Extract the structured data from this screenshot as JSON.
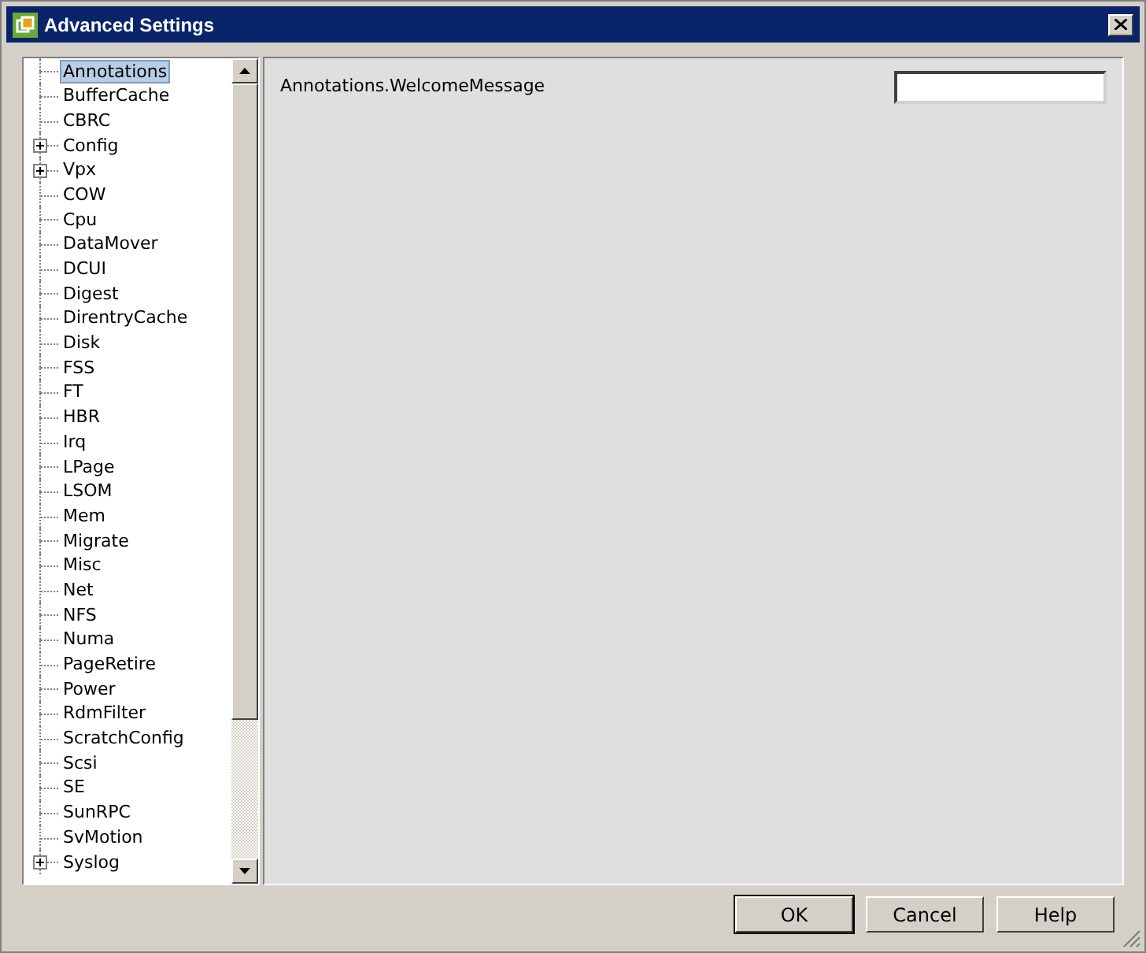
{
  "window": {
    "title": "Advanced Settings"
  },
  "tree": {
    "items": [
      {
        "label": "Annotations",
        "kind": "leaf",
        "selected": true
      },
      {
        "label": "BufferCache",
        "kind": "leaf",
        "selected": false
      },
      {
        "label": "CBRC",
        "kind": "leaf",
        "selected": false
      },
      {
        "label": "Config",
        "kind": "group",
        "selected": false
      },
      {
        "label": "Vpx",
        "kind": "group",
        "selected": false
      },
      {
        "label": "COW",
        "kind": "leaf",
        "selected": false
      },
      {
        "label": "Cpu",
        "kind": "leaf",
        "selected": false
      },
      {
        "label": "DataMover",
        "kind": "leaf",
        "selected": false
      },
      {
        "label": "DCUI",
        "kind": "leaf",
        "selected": false
      },
      {
        "label": "Digest",
        "kind": "leaf",
        "selected": false
      },
      {
        "label": "DirentryCache",
        "kind": "leaf",
        "selected": false
      },
      {
        "label": "Disk",
        "kind": "leaf",
        "selected": false
      },
      {
        "label": "FSS",
        "kind": "leaf",
        "selected": false
      },
      {
        "label": "FT",
        "kind": "leaf",
        "selected": false
      },
      {
        "label": "HBR",
        "kind": "leaf",
        "selected": false
      },
      {
        "label": "Irq",
        "kind": "leaf",
        "selected": false
      },
      {
        "label": "LPage",
        "kind": "leaf",
        "selected": false
      },
      {
        "label": "LSOM",
        "kind": "leaf",
        "selected": false
      },
      {
        "label": "Mem",
        "kind": "leaf",
        "selected": false
      },
      {
        "label": "Migrate",
        "kind": "leaf",
        "selected": false
      },
      {
        "label": "Misc",
        "kind": "leaf",
        "selected": false
      },
      {
        "label": "Net",
        "kind": "leaf",
        "selected": false
      },
      {
        "label": "NFS",
        "kind": "leaf",
        "selected": false
      },
      {
        "label": "Numa",
        "kind": "leaf",
        "selected": false
      },
      {
        "label": "PageRetire",
        "kind": "leaf",
        "selected": false
      },
      {
        "label": "Power",
        "kind": "leaf",
        "selected": false
      },
      {
        "label": "RdmFilter",
        "kind": "leaf",
        "selected": false
      },
      {
        "label": "ScratchConfig",
        "kind": "leaf",
        "selected": false
      },
      {
        "label": "Scsi",
        "kind": "leaf",
        "selected": false
      },
      {
        "label": "SE",
        "kind": "leaf",
        "selected": false
      },
      {
        "label": "SunRPC",
        "kind": "leaf",
        "selected": false
      },
      {
        "label": "SvMotion",
        "kind": "leaf",
        "selected": false
      },
      {
        "label": "Syslog",
        "kind": "group",
        "selected": false
      }
    ]
  },
  "settings": [
    {
      "label": "Annotations.WelcomeMessage"
    }
  ],
  "buttons": [
    {
      "label": "OK",
      "default": true
    },
    {
      "label": "Cancel",
      "default": false
    },
    {
      "label": "Help",
      "default": false
    }
  ]
}
